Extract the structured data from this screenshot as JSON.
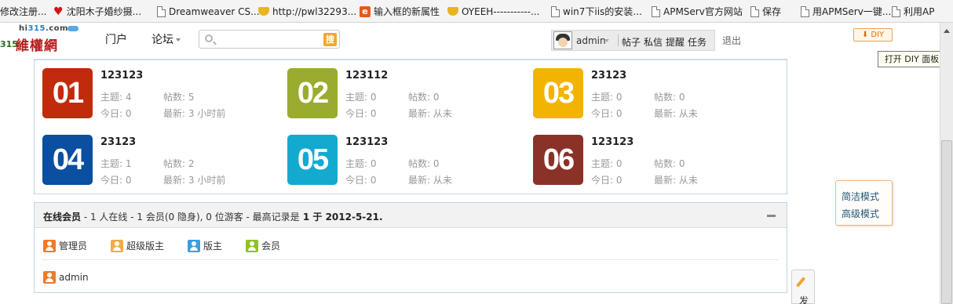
{
  "bookmarks": [
    {
      "label": "修改注册...",
      "icon": "none"
    },
    {
      "label": "沈阳木子婚纱摄...",
      "icon": "heart-icon"
    },
    {
      "label": "Dreamweaver CS...",
      "icon": "page-icon"
    },
    {
      "label": "http://pwl32293...",
      "icon": "cup-icon"
    },
    {
      "label": "输入框的新属性",
      "icon": "e-icon"
    },
    {
      "label": "OYEEH-----------...",
      "icon": "cup-icon"
    },
    {
      "label": "win7下iis的安装...",
      "icon": "page-icon"
    },
    {
      "label": "APMServ官方网站",
      "icon": "page-icon"
    },
    {
      "label": "保存",
      "icon": "page-icon"
    },
    {
      "label": "用APMServ一键...",
      "icon": "page-icon"
    },
    {
      "label": "利用AP",
      "icon": "page-icon"
    }
  ],
  "logo": {
    "domain_prefix": "hi",
    "domain_num": "315",
    "domain_suffix": ".com",
    "num": "315",
    "cn": "維權網"
  },
  "nav": {
    "portal": "门户",
    "forum": "论坛"
  },
  "search": {
    "placeholder": "",
    "button": "搜"
  },
  "user": {
    "name": "admin",
    "links": [
      "帖子",
      "私信",
      "提醒",
      "任务"
    ],
    "logout": "退出"
  },
  "diy": {
    "button": "DIY",
    "tooltip": "打开 DIY 面板"
  },
  "forums": [
    {
      "num": "01",
      "color": "#c22a0c",
      "name": "123123",
      "topics_label": "主题:",
      "topics": "4",
      "posts_label": "帖数:",
      "posts": "5",
      "today_label": "今日:",
      "today": "0",
      "latest_label": "最新:",
      "latest": "3 小时前"
    },
    {
      "num": "02",
      "color": "#9bab2f",
      "name": "123112",
      "topics_label": "主题:",
      "topics": "0",
      "posts_label": "帖数:",
      "posts": "0",
      "today_label": "今日:",
      "today": "0",
      "latest_label": "最新:",
      "latest": "从未"
    },
    {
      "num": "03",
      "color": "#f2b301",
      "name": "23123",
      "topics_label": "主题:",
      "topics": "0",
      "posts_label": "帖数:",
      "posts": "0",
      "today_label": "今日:",
      "today": "0",
      "latest_label": "最新:",
      "latest": "从未"
    },
    {
      "num": "04",
      "color": "#0a4fa0",
      "name": "23123",
      "topics_label": "主题:",
      "topics": "1",
      "posts_label": "帖数:",
      "posts": "2",
      "today_label": "今日:",
      "today": "0",
      "latest_label": "最新:",
      "latest": "3 小时前"
    },
    {
      "num": "05",
      "color": "#14a9cf",
      "name": "123123",
      "topics_label": "主题:",
      "topics": "0",
      "posts_label": "帖数:",
      "posts": "0",
      "today_label": "今日:",
      "today": "0",
      "latest_label": "最新:",
      "latest": "从未"
    },
    {
      "num": "06",
      "color": "#8a3228",
      "name": "123123",
      "topics_label": "主题:",
      "topics": "0",
      "posts_label": "帖数:",
      "posts": "0",
      "today_label": "今日:",
      "today": "0",
      "latest_label": "最新:",
      "latest": "从未"
    }
  ],
  "online": {
    "title": "在线会员",
    "summary": " - 1 人在线 - 1 会员(0 隐身), 0 位游客 - 最高记录是",
    "record": " 1 于 2012-5-21.",
    "legend": [
      {
        "label": "管理员",
        "color": "#f07a2a"
      },
      {
        "label": "超级版主",
        "color": "#f5a94a"
      },
      {
        "label": "版主",
        "color": "#3a9ee0"
      },
      {
        "label": "会员",
        "color": "#8fc228"
      }
    ],
    "members": [
      {
        "name": "admin",
        "color": "#f07a2a"
      }
    ]
  },
  "modes": {
    "simple": "简洁模式",
    "advanced": "高级模式"
  },
  "post_tab": "发"
}
